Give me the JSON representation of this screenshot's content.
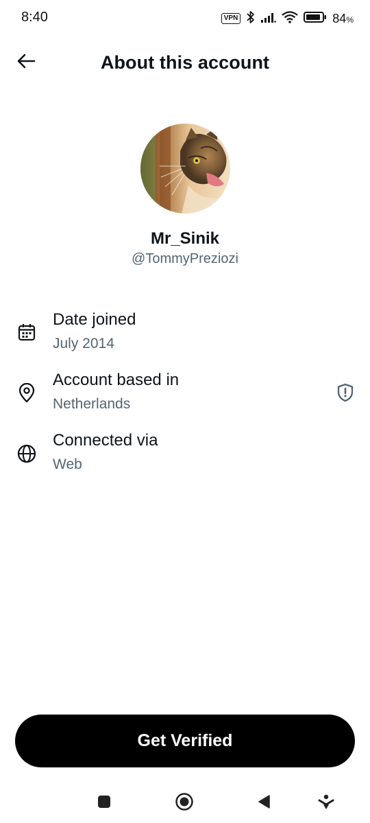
{
  "status_bar": {
    "time": "8:40",
    "vpn_label": "VPN",
    "battery_level": "84",
    "battery_unit": "%",
    "icons": [
      "vpn-icon",
      "bluetooth-icon",
      "signal-icon",
      "wifi-icon",
      "battery-icon"
    ]
  },
  "header": {
    "title": "About this account",
    "back_icon": "arrow-left-icon"
  },
  "profile": {
    "display_name": "Mr_Sinik",
    "handle": "@TommyPreziozi"
  },
  "info": [
    {
      "title": "Date joined",
      "value": "July 2014",
      "icon": "calendar-icon"
    },
    {
      "title": "Account based in",
      "value": "Netherlands",
      "icon": "location-pin-icon",
      "badge_icon": "shield-alert-icon"
    },
    {
      "title": "Connected via",
      "value": "Web",
      "icon": "globe-icon"
    }
  ],
  "cta": {
    "label": "Get Verified"
  },
  "nav_bar": {
    "icons": [
      "recents-square-icon",
      "home-circle-icon",
      "back-triangle-icon",
      "assistant-icon"
    ]
  },
  "colors": {
    "primary_text": "#0f1419",
    "secondary_text": "#536471",
    "cta_bg": "#000000",
    "cta_text": "#ffffff"
  }
}
